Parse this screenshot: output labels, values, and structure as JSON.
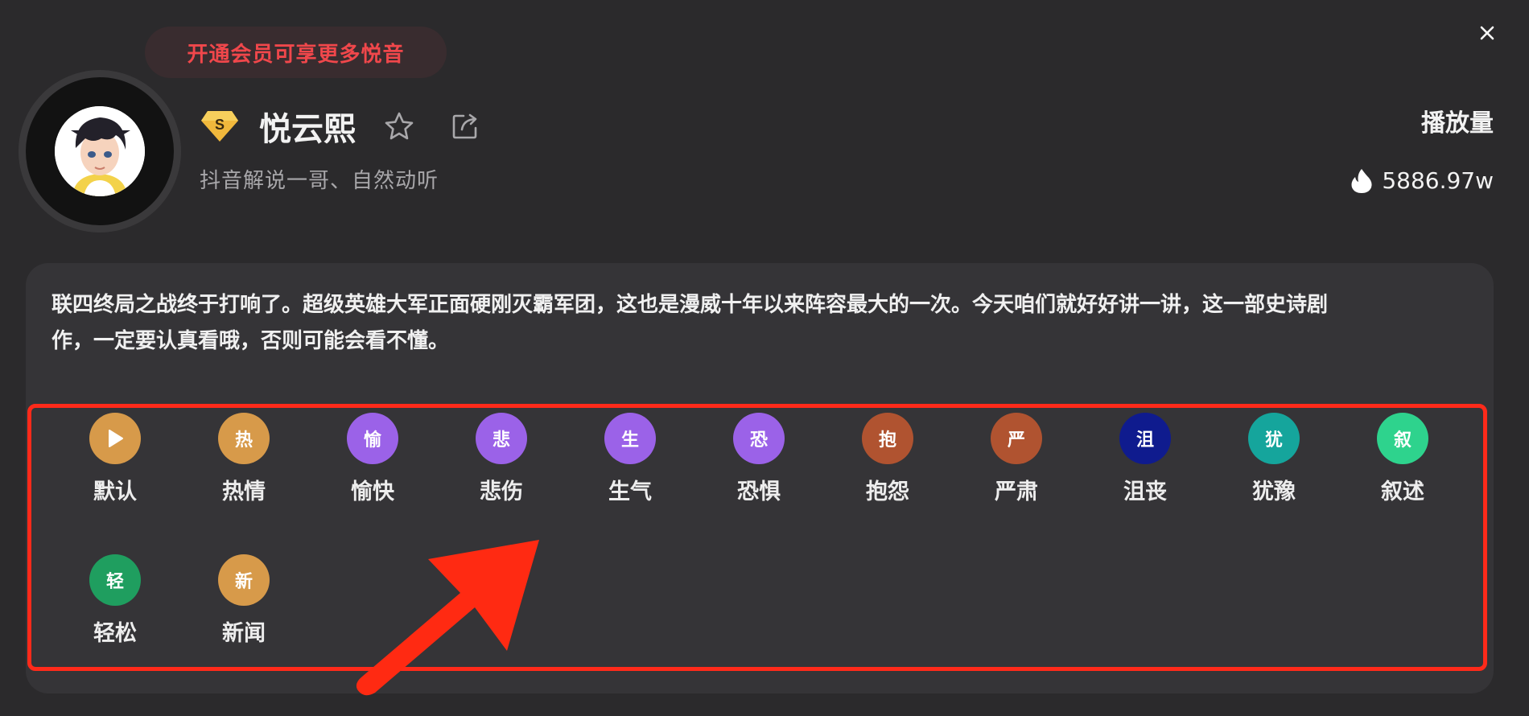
{
  "vip_banner": "开通会员可享更多悦音",
  "voice": {
    "name": "悦云熙",
    "description": "抖音解说一哥、自然动听",
    "badge": "S"
  },
  "stats": {
    "plays_label": "播放量",
    "plays_value": "5886.97w"
  },
  "sample_text_line1": "联四终局之战终于打响了。超级英雄大军正面硬刚灭霸军团，这也是漫威十年以来阵容最大的一次。今天咱们就好好讲一讲，这一部史诗剧",
  "sample_text_line2": "作，一定要认真看哦，否则可能会看不懂。",
  "emotions": [
    {
      "label": "默认",
      "glyph": "",
      "color": "#d79a4a",
      "icon": "play-icon"
    },
    {
      "label": "热情",
      "glyph": "热",
      "color": "#d79a4a"
    },
    {
      "label": "愉快",
      "glyph": "愉",
      "color": "#9b62e8"
    },
    {
      "label": "悲伤",
      "glyph": "悲",
      "color": "#9b62e8"
    },
    {
      "label": "生气",
      "glyph": "生",
      "color": "#9b62e8"
    },
    {
      "label": "恐惧",
      "glyph": "恐",
      "color": "#9b62e8"
    },
    {
      "label": "抱怨",
      "glyph": "抱",
      "color": "#b05330"
    },
    {
      "label": "严肃",
      "glyph": "严",
      "color": "#b05330"
    },
    {
      "label": "沮丧",
      "glyph": "沮",
      "color": "#0f1b8e"
    },
    {
      "label": "犹豫",
      "glyph": "犹",
      "color": "#15a59c"
    },
    {
      "label": "叙述",
      "glyph": "叙",
      "color": "#2ed38d"
    },
    {
      "label": "轻松",
      "glyph": "轻",
      "color": "#1f9e5f"
    },
    {
      "label": "新闻",
      "glyph": "新",
      "color": "#d79a4a"
    }
  ],
  "colors": {
    "background": "#2b2a2c",
    "card": "#353437",
    "vip_text": "#f0474b",
    "highlight": "#ff2a1a"
  }
}
